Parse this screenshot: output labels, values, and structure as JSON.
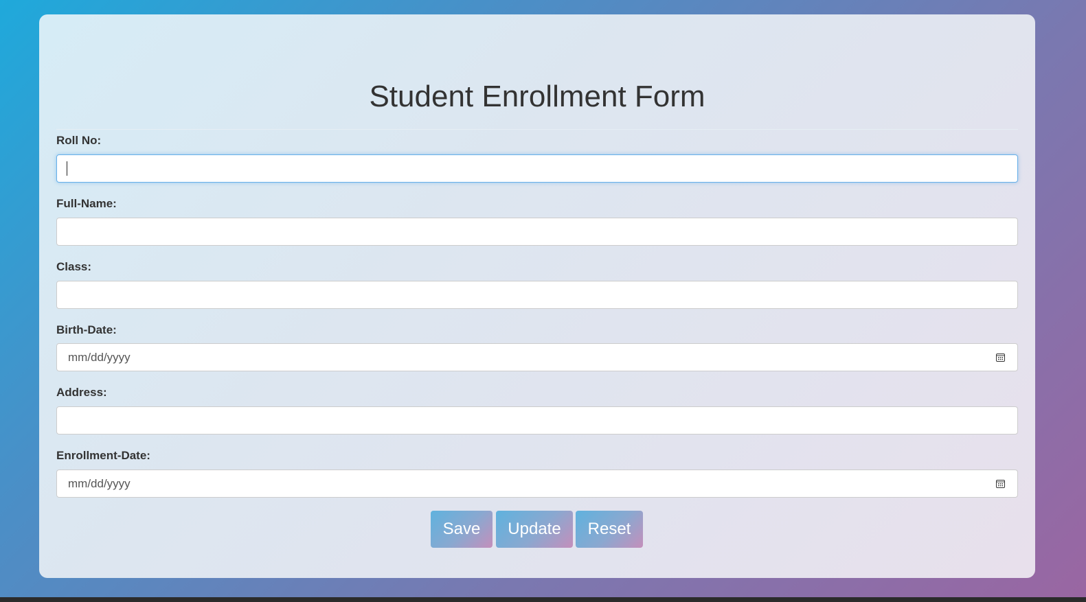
{
  "form": {
    "title": "Student Enrollment Form",
    "fields": [
      {
        "label": "Roll No:",
        "value": "",
        "type": "text",
        "focused": true
      },
      {
        "label": "Full-Name:",
        "value": "",
        "type": "text"
      },
      {
        "label": "Class:",
        "value": "",
        "type": "text"
      },
      {
        "label": "Birth-Date:",
        "placeholder": "mm/dd/yyyy",
        "type": "date",
        "icon": "calendar-icon"
      },
      {
        "label": "Address:",
        "value": "",
        "type": "text"
      },
      {
        "label": "Enrollment-Date:",
        "placeholder": "mm/dd/yyyy",
        "type": "date",
        "icon": "calendar-icon"
      }
    ],
    "buttons": {
      "save_label": "Save",
      "update_label": "Update",
      "reset_label": "Reset"
    }
  },
  "colors": {
    "focus_border": "#66afe9",
    "text": "#333333"
  }
}
